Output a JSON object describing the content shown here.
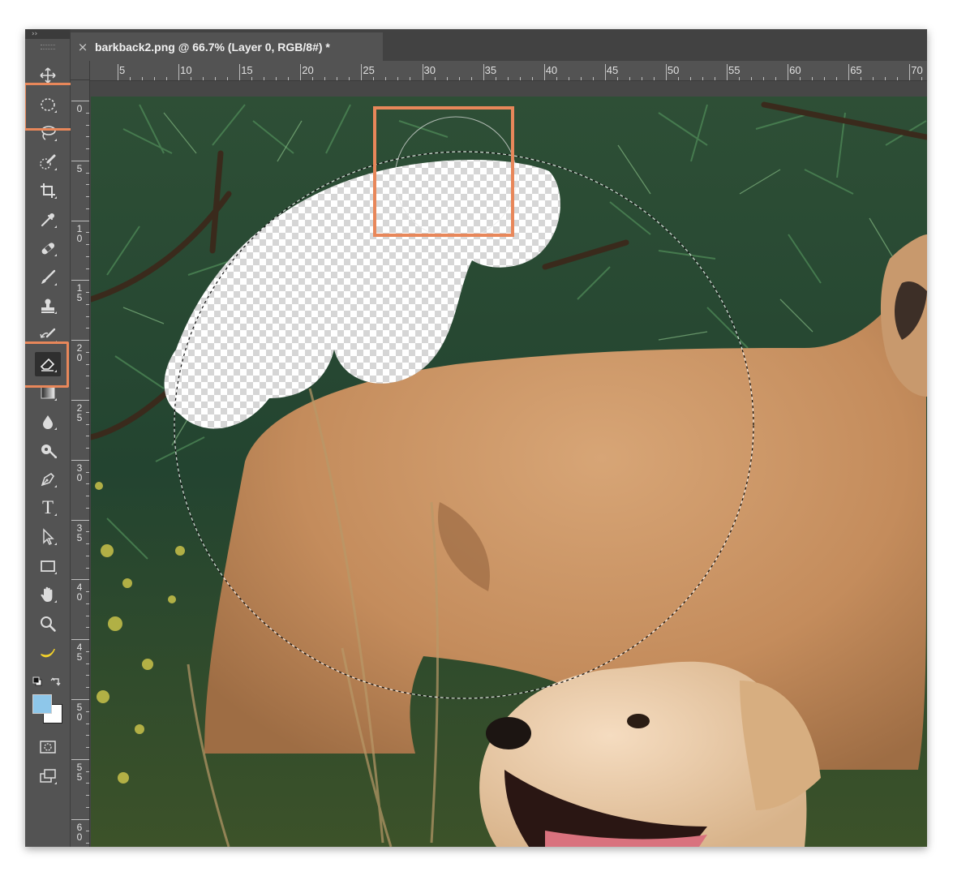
{
  "tabbar": {
    "close_glyph": "×",
    "document_title": "barkback2.png @ 66.7% (Layer 0, RGB/8#) *"
  },
  "toolbar": {
    "collapse_glyph": "››",
    "tools": [
      {
        "name": "move-tool",
        "icon": "move-icon"
      },
      {
        "name": "elliptical-marquee-tool",
        "icon": "elliptical-marquee-icon",
        "highlighted": true
      },
      {
        "name": "lasso-tool",
        "icon": "lasso-icon"
      },
      {
        "name": "quick-selection-tool",
        "icon": "quick-selection-icon"
      },
      {
        "name": "crop-tool",
        "icon": "crop-icon"
      },
      {
        "name": "eyedropper-tool",
        "icon": "eyedropper-icon"
      },
      {
        "name": "healing-brush-tool",
        "icon": "bandage-icon"
      },
      {
        "name": "brush-tool",
        "icon": "brush-icon"
      },
      {
        "name": "clone-stamp-tool",
        "icon": "stamp-icon"
      },
      {
        "name": "history-brush-tool",
        "icon": "history-brush-icon"
      },
      {
        "name": "eraser-tool",
        "icon": "eraser-icon",
        "active": true,
        "highlighted": true
      },
      {
        "name": "gradient-tool",
        "icon": "gradient-icon"
      },
      {
        "name": "blur-tool",
        "icon": "drop-icon"
      },
      {
        "name": "dodge-tool",
        "icon": "dodge-icon"
      },
      {
        "name": "pen-tool",
        "icon": "pen-icon"
      },
      {
        "name": "type-tool",
        "icon": "type-icon",
        "glyph": "T"
      },
      {
        "name": "path-selection-tool",
        "icon": "arrow-cursor-icon"
      },
      {
        "name": "rectangle-tool",
        "icon": "rectangle-icon"
      },
      {
        "name": "hand-tool",
        "icon": "hand-icon"
      },
      {
        "name": "zoom-tool",
        "icon": "magnifier-icon"
      },
      {
        "name": "custom-banana-tool",
        "icon": "banana-icon"
      },
      {
        "name": "quick-mask-button",
        "icon": "quick-mask-icon"
      },
      {
        "name": "screen-mode-button",
        "icon": "screen-mode-icon"
      }
    ],
    "foreground_color": "#8ec7ea",
    "background_color": "#ffffff"
  },
  "ruler": {
    "horizontal_labels": [
      "5",
      "10",
      "15",
      "20",
      "25",
      "30",
      "35",
      "40",
      "45",
      "50",
      "55",
      "60",
      "65",
      "70"
    ],
    "vertical_labels": [
      [
        "0"
      ],
      [
        "5"
      ],
      [
        "1",
        "0"
      ],
      [
        "1",
        "5"
      ],
      [
        "2",
        "0"
      ],
      [
        "2",
        "5"
      ],
      [
        "3",
        "0"
      ],
      [
        "3",
        "5"
      ],
      [
        "4",
        "0"
      ],
      [
        "4",
        "5"
      ],
      [
        "5",
        "0"
      ],
      [
        "5",
        "5"
      ],
      [
        "6",
        "0"
      ]
    ]
  },
  "colors": {
    "highlight_annotation": "#e8875a",
    "ui_panel": "#535353",
    "tab_bar": "#424242"
  },
  "canvas": {
    "subject": "two golden retriever dogs in front of pine branches, with a cloud-shaped erased (transparent) area and an elliptical selection marquee"
  }
}
